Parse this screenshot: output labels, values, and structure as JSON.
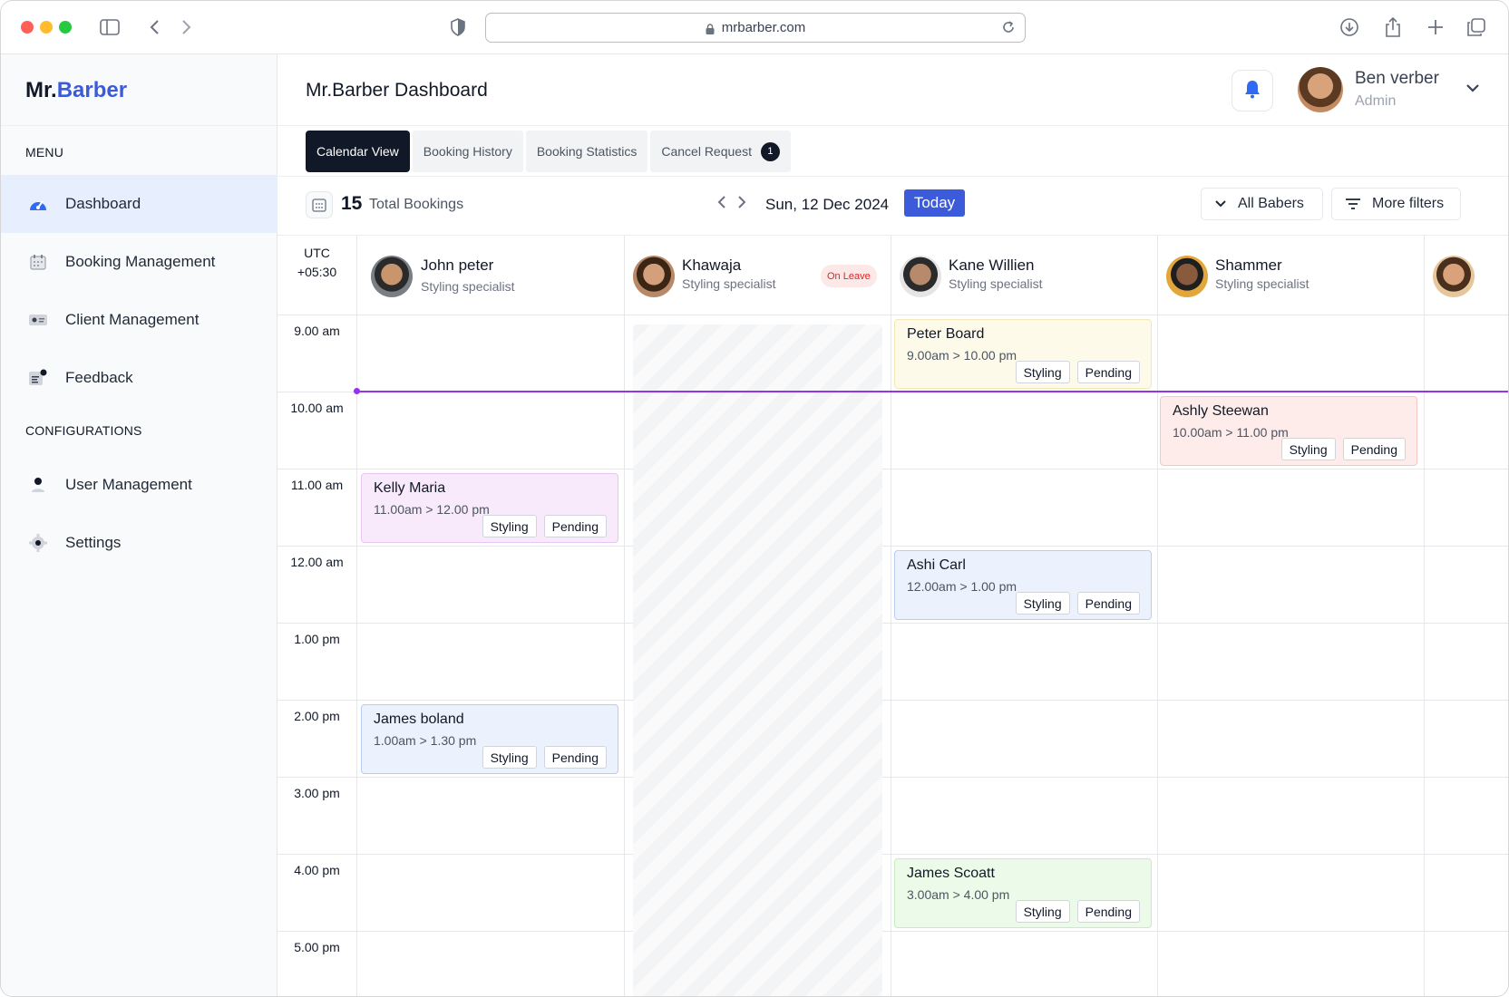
{
  "browser": {
    "url": "mrbarber.com"
  },
  "sidebar": {
    "brand_prefix": "Mr.",
    "brand_accent": "Barber",
    "menu_title": "MENU",
    "config_title": "CONFIGURATIONS",
    "menu_items": [
      {
        "label": "Dashboard",
        "icon": "dashboard-icon",
        "active": true
      },
      {
        "label": "Booking Management",
        "icon": "calendar-icon"
      },
      {
        "label": "Client Management",
        "icon": "id-card-icon"
      },
      {
        "label": "Feedback",
        "icon": "feedback-icon"
      }
    ],
    "config_items": [
      {
        "label": "User Management",
        "icon": "user-icon"
      },
      {
        "label": "Settings",
        "icon": "gear-icon"
      }
    ]
  },
  "header": {
    "title": "Mr.Barber Dashboard",
    "user_name": "Ben verber",
    "user_role": "Admin"
  },
  "tabs": [
    {
      "label": "Calendar View",
      "active": true
    },
    {
      "label": "Booking History"
    },
    {
      "label": "Booking Statistics"
    },
    {
      "label": "Cancel Request",
      "badge": "1"
    }
  ],
  "toolbar": {
    "total_count": "15",
    "total_label": "Total Bookings",
    "date": "Sun, 12 Dec 2024",
    "today_label": "Today",
    "barbers_filter": "All Babers",
    "more_filters": "More filters"
  },
  "calendar": {
    "timezone_line1": "UTC",
    "timezone_line2": "+05:30",
    "time_slots": [
      "9.00 am",
      "10.00 am",
      "11.00 am",
      "12.00 am",
      "1.00 pm",
      "2.00 pm",
      "3.00 pm",
      "4.00 pm",
      "5.00 pm"
    ],
    "barbers": [
      {
        "name": "John peter",
        "role": "Styling specialist"
      },
      {
        "name": "Khawaja",
        "role": "Styling specialist",
        "status": "On Leave"
      },
      {
        "name": "Kane Willien",
        "role": "Styling specialist"
      },
      {
        "name": "Shammer",
        "role": "Styling specialist"
      }
    ],
    "events": [
      {
        "client": "Peter Board",
        "time": "9.00am > 10.00 pm",
        "service": "Styling",
        "status": "Pending"
      },
      {
        "client": "Ashly Steewan",
        "time": "10.00am > 11.00 pm",
        "service": "Styling",
        "status": "Pending"
      },
      {
        "client": "Kelly Maria",
        "time": "11.00am > 12.00 pm",
        "service": "Styling",
        "status": "Pending"
      },
      {
        "client": "Ashi Carl",
        "time": "12.00am > 1.00 pm",
        "service": "Styling",
        "status": "Pending"
      },
      {
        "client": "James boland",
        "time": "1.00am > 1.30 pm",
        "service": "Styling",
        "status": "Pending"
      },
      {
        "client": "James Scoatt",
        "time": "3.00am > 4.00 pm",
        "service": "Styling",
        "status": "Pending"
      }
    ]
  },
  "colors": {
    "brand_blue": "#3b5bdb",
    "current_time_line": "#9333ea",
    "leave_badge": "#dc2626"
  }
}
